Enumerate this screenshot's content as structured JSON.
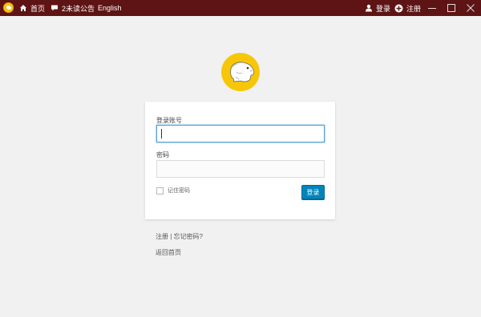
{
  "titlebar": {
    "home": "首页",
    "notices": "2未读公告",
    "language": "English",
    "login": "登录",
    "register": "注册"
  },
  "icons": {
    "app_logo": "app-logo-icon",
    "home": "home-icon",
    "notices": "speech-bubble-icon",
    "login": "user-icon",
    "register": "plus-circle-icon",
    "minimize": "minimize-icon",
    "maximize": "maximize-icon",
    "close": "close-icon"
  },
  "login_form": {
    "account_label": "登录账号",
    "account_value": "",
    "password_label": "密码",
    "password_value": "",
    "remember_label": "记住密码",
    "remember_checked": false,
    "submit_label": "登录"
  },
  "links": {
    "register": "注册",
    "separator": "|",
    "forgot": "忘记密码?",
    "back_home": "返回首页"
  },
  "colors": {
    "titlebar_bg": "#5e1414",
    "page_bg": "#f1f1f1",
    "logo_bg": "#f7c707",
    "button_bg": "#0085ba",
    "focus_border": "#5b9dd9"
  }
}
